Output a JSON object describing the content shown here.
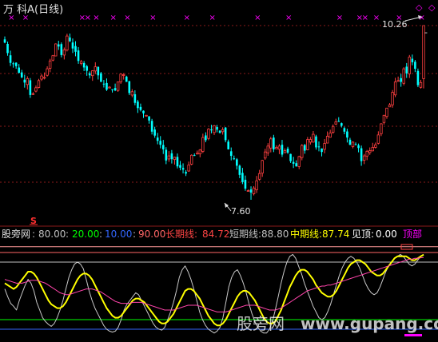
{
  "window": {
    "title": "万 科A(日线)"
  },
  "price_panel": {
    "high_label": "10.26",
    "low_label": "7.60",
    "s_marker": "S",
    "x_marker": "×",
    "diamond_marker": "◇",
    "dash_marker": "-"
  },
  "indicator_panel": {
    "name": "股旁网",
    "levels": [
      {
        "text": "80.00",
        "color": "#c0c0c0"
      },
      {
        "text": "20.00",
        "color": "#00ff00"
      },
      {
        "text": "10.00",
        "color": "#3366ff"
      },
      {
        "text": "90.00",
        "color": "#ff6666"
      }
    ],
    "long_label": "长期线:",
    "long_value": "84.72",
    "short_label": "短期线:",
    "short_value": "88.80",
    "mid_label": "中期线:",
    "mid_value": "87.74",
    "top_label": "见顶:",
    "top_value": "0.00",
    "top_badge": "顶部",
    "sep": ":",
    "long_color": "#ff4444",
    "short_color": "#c0c0c0",
    "mid_color": "#ffff00",
    "top_color": "#ffffff",
    "badge_color": "#ff00ff"
  },
  "watermark": {
    "cn": "股旁网",
    "url": "www.gupang.com"
  },
  "colors": {
    "up": "#ff4040",
    "down": "#00ffff",
    "grid": "#8b1a1a",
    "background": "#000000",
    "marker_x": "#ff00ff"
  },
  "chart_data": {
    "type": "candlestick",
    "price_min": 7.6,
    "price_max": 10.26,
    "indicator_range": [
      0,
      100
    ],
    "indicator_levels": [
      80,
      20,
      10,
      90
    ],
    "indicator_values": {
      "long": 84.72,
      "short": 88.8,
      "mid": 87.74,
      "top": 0.0
    },
    "closes": [
      10.0,
      9.84,
      9.69,
      9.68,
      9.64,
      9.54,
      9.47,
      9.39,
      9.45,
      9.2,
      9.22,
      9.31,
      9.42,
      9.49,
      9.47,
      9.6,
      9.72,
      9.8,
      9.98,
      9.94,
      9.81,
      9.89,
      10.1,
      10.02,
      9.91,
      9.86,
      9.72,
      9.71,
      9.62,
      9.57,
      9.5,
      9.57,
      9.63,
      9.5,
      9.4,
      9.37,
      9.28,
      9.32,
      9.28,
      9.27,
      9.4,
      9.52,
      9.51,
      9.4,
      9.23,
      9.25,
      9.08,
      9.0,
      8.97,
      8.92,
      8.89,
      8.81,
      8.64,
      8.58,
      8.5,
      8.44,
      8.37,
      8.2,
      8.27,
      8.22,
      8.25,
      8.11,
      8.09,
      8.06,
      8.0,
      8.13,
      8.28,
      8.27,
      8.31,
      8.36,
      8.55,
      8.51,
      8.68,
      8.66,
      8.73,
      8.67,
      8.62,
      8.67,
      8.51,
      8.37,
      8.27,
      8.23,
      8.12,
      7.98,
      7.87,
      7.77,
      7.74,
      7.71,
      7.78,
      7.89,
      8.0,
      8.2,
      8.33,
      8.42,
      8.53,
      8.37,
      8.4,
      8.42,
      8.29,
      8.35,
      8.32,
      8.19,
      8.15,
      8.11,
      8.26,
      8.43,
      8.35,
      8.52,
      8.52,
      8.6,
      8.4,
      8.41,
      8.33,
      8.46,
      8.57,
      8.62,
      8.72,
      8.79,
      8.79,
      8.73,
      8.64,
      8.55,
      8.44,
      8.48,
      8.44,
      8.39,
      8.19,
      8.27,
      8.34,
      8.35,
      8.4,
      8.44,
      8.59,
      8.76,
      8.89,
      9.0,
      9.05,
      9.24,
      9.4,
      9.42,
      9.4,
      9.6,
      9.53,
      9.78,
      9.7,
      9.6,
      9.35,
      9.39,
      10.26
    ],
    "series": [
      {
        "name": "短期线",
        "values": [
          52,
          44,
          37,
          34,
          30,
          40,
          48,
          56,
          62,
          58,
          50,
          38,
          30,
          22,
          18,
          15,
          13,
          16,
          22,
          30,
          40,
          52,
          64,
          72,
          78,
          80,
          78,
          73,
          62,
          50,
          40,
          32,
          26,
          20,
          14,
          10,
          8,
          7,
          8,
          12,
          20,
          30,
          36,
          40,
          44,
          48,
          46,
          40,
          34,
          28,
          22,
          16,
          12,
          10,
          9,
          12,
          20,
          28,
          38,
          50,
          64,
          72,
          76,
          70,
          62,
          52,
          40,
          28,
          20,
          14,
          10,
          8,
          6,
          8,
          12,
          22,
          38,
          54,
          64,
          70,
          72,
          66,
          58,
          48,
          36,
          26,
          18,
          12,
          8,
          6,
          6,
          10,
          18,
          30,
          44,
          58,
          70,
          80,
          86,
          88,
          84,
          76,
          68,
          58,
          50,
          42,
          34,
          28,
          22,
          20,
          22,
          28,
          36,
          46,
          56,
          66,
          74,
          80,
          84,
          86,
          84,
          80,
          74,
          66,
          58,
          52,
          48,
          46,
          48,
          54,
          62,
          70,
          76,
          80,
          84,
          86,
          88,
          86,
          82,
          78,
          76,
          78,
          82,
          86,
          88
        ]
      },
      {
        "name": "中期线",
        "values": [
          58,
          56,
          54,
          52,
          54,
          58,
          62,
          66,
          70,
          70,
          68,
          64,
          58,
          52,
          46,
          40,
          36,
          34,
          32,
          32,
          34,
          38,
          44,
          50,
          56,
          62,
          66,
          68,
          68,
          66,
          62,
          56,
          50,
          44,
          38,
          32,
          28,
          24,
          22,
          22,
          24,
          28,
          32,
          36,
          40,
          42,
          42,
          40,
          38,
          34,
          30,
          26,
          22,
          18,
          16,
          16,
          18,
          22,
          26,
          32,
          38,
          44,
          50,
          52,
          52,
          50,
          46,
          42,
          36,
          30,
          24,
          20,
          16,
          14,
          14,
          16,
          20,
          26,
          32,
          38,
          44,
          48,
          50,
          50,
          48,
          44,
          40,
          34,
          28,
          22,
          18,
          16,
          16,
          18,
          24,
          30,
          38,
          46,
          54,
          60,
          66,
          70,
          72,
          72,
          70,
          66,
          62,
          56,
          52,
          48,
          46,
          44,
          44,
          46,
          50,
          56,
          62,
          68,
          74,
          78,
          80,
          82,
          82,
          80,
          78,
          74,
          70,
          68,
          66,
          66,
          68,
          72,
          76,
          80,
          84,
          86,
          86,
          86,
          86,
          84,
          82,
          82,
          84,
          86,
          87.74
        ]
      },
      {
        "name": "长期线",
        "values": [
          62,
          61,
          60,
          59,
          58,
          58,
          58,
          59,
          60,
          61,
          61,
          61,
          60,
          59,
          58,
          56,
          54,
          52,
          50,
          48,
          47,
          46,
          46,
          47,
          48,
          49,
          50,
          51,
          52,
          52,
          52,
          51,
          50,
          49,
          47,
          45,
          43,
          41,
          39,
          38,
          37,
          37,
          37,
          37,
          38,
          38,
          38,
          38,
          37,
          36,
          35,
          34,
          33,
          32,
          31,
          30,
          30,
          30,
          30,
          31,
          32,
          33,
          34,
          35,
          35,
          35,
          35,
          34,
          33,
          32,
          31,
          30,
          29,
          28,
          28,
          28,
          28,
          29,
          30,
          31,
          32,
          33,
          34,
          35,
          35,
          35,
          35,
          34,
          33,
          32,
          31,
          30,
          30,
          30,
          31,
          32,
          34,
          36,
          38,
          40,
          42,
          44,
          46,
          48,
          50,
          51,
          52,
          53,
          54,
          55,
          55,
          56,
          56,
          57,
          58,
          59,
          60,
          61,
          62,
          63,
          64,
          65,
          66,
          67,
          68,
          69,
          70,
          71,
          72,
          73,
          74,
          75,
          76,
          77,
          78,
          79,
          80,
          81,
          82,
          83,
          83,
          84,
          84,
          84.5,
          84.72
        ]
      }
    ]
  }
}
